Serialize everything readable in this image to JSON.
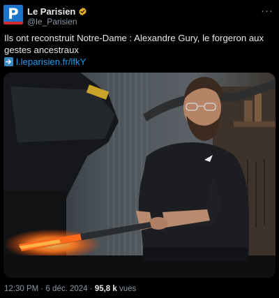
{
  "account": {
    "avatar_letter": "P",
    "display_name": "Le Parisien",
    "handle": "@le_Parisien",
    "verified_icon": "verified-badge-gold",
    "brand_colors": {
      "avatar_bg": "#1a74c9",
      "avatar_bar": "#d22a2a",
      "badge": "#e6b325"
    }
  },
  "more_label": "···",
  "tweet": {
    "text": "Ils ont reconstruit Notre-Dame : Alexandre Gury, le forgeron aux gestes ancestraux",
    "link_icon": "right-arrow-emoji",
    "link_text": "l.leparisien.fr/lfkY"
  },
  "media": {
    "description_icon": "photo-blacksmith-forging"
  },
  "footer": {
    "time": "12:30 PM",
    "separator": " · ",
    "date": "6 déc. 2024",
    "views_count": "95,8 k",
    "views_label": " vues"
  },
  "colors": {
    "background": "#000000",
    "text": "#e7e9ea",
    "secondary": "#8b98a5",
    "link": "#1d9bf0"
  }
}
